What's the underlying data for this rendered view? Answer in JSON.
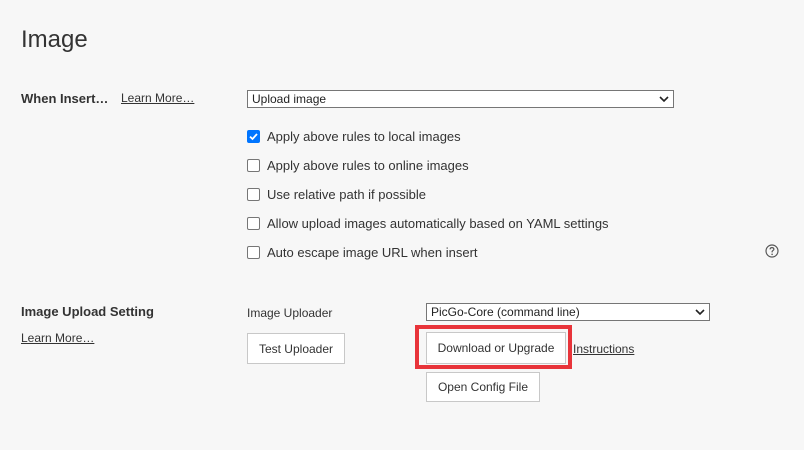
{
  "page": {
    "title": "Image"
  },
  "insert_section": {
    "label": "When Insert…",
    "learn_more": "Learn More…",
    "action_select": {
      "value": "Upload image"
    },
    "options": [
      {
        "label": "Apply above rules to local images",
        "checked": true
      },
      {
        "label": "Apply above rules to online images",
        "checked": false
      },
      {
        "label": "Use relative path if possible",
        "checked": false
      },
      {
        "label": "Allow upload images automatically based on YAML settings",
        "checked": false
      },
      {
        "label": "Auto escape image URL when insert",
        "checked": false
      }
    ],
    "help_icon": "question-circle-icon"
  },
  "upload_section": {
    "label": "Image Upload Setting",
    "learn_more": "Learn More…",
    "uploader_label": "Image Uploader",
    "uploader_select": {
      "value": "PicGo-Core (command line)"
    },
    "test_button": "Test Uploader",
    "download_button": "Download or Upgrade",
    "instructions_link": "Instructions",
    "open_config_button": "Open Config File"
  },
  "colors": {
    "background": "#f7f7f7",
    "checkbox_checked": "#0075ff",
    "highlight": "#e8343a"
  }
}
